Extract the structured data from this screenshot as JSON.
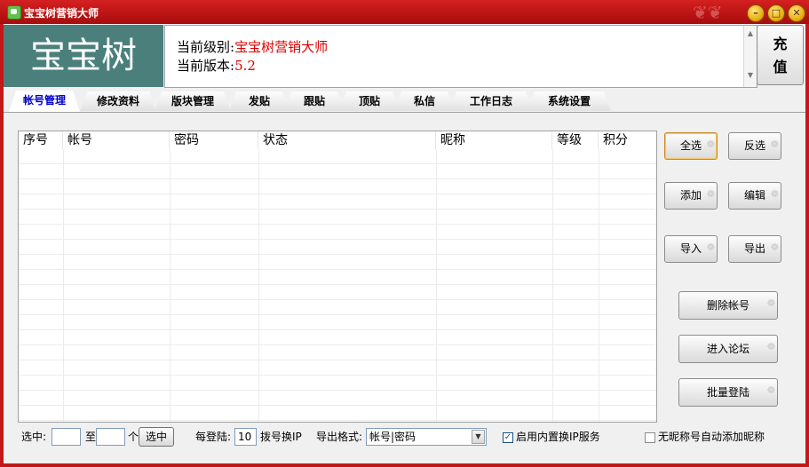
{
  "window": {
    "title": "宝宝树营销大师"
  },
  "header": {
    "logo_text": "宝宝树",
    "level_label": "当前级别:",
    "level_value": "宝宝树营销大师",
    "version_label": "当前版本:",
    "version_value": "5.2",
    "charge_label_1": "充",
    "charge_label_2": "值"
  },
  "tabs": [
    {
      "label": "帐号管理",
      "active": true
    },
    {
      "label": "修改资料"
    },
    {
      "label": "版块管理"
    },
    {
      "label": "发贴"
    },
    {
      "label": "跟贴"
    },
    {
      "label": "顶贴"
    },
    {
      "label": "私信"
    },
    {
      "label": "工作日志"
    },
    {
      "label": "系统设置"
    }
  ],
  "grid": {
    "columns": [
      "序号",
      "帐号",
      "密码",
      "状态",
      "昵称",
      "等级",
      "积分"
    ],
    "rows": []
  },
  "buttons": {
    "select_all": "全选",
    "invert": "反选",
    "add": "添加",
    "edit": "编辑",
    "import": "导入",
    "export": "导出",
    "delete_account": "删除帐号",
    "enter_forum": "进入论坛",
    "batch_login": "批量登陆"
  },
  "bottom": {
    "select_label": "选中:",
    "from_value": "",
    "to_label": "至",
    "to_value": "",
    "unit_label": "个",
    "select_button": "选中",
    "per_login_label": "每登陆:",
    "per_login_value": "10",
    "switch_ip_label": "拨号换IP",
    "export_format_label": "导出格式:",
    "export_format_value": "帐号|密码",
    "builtin_ip_label": "启用内置换IP服务",
    "builtin_ip_checked": true,
    "auto_nick_label": "无昵称号自动添加昵称",
    "auto_nick_checked": false
  }
}
